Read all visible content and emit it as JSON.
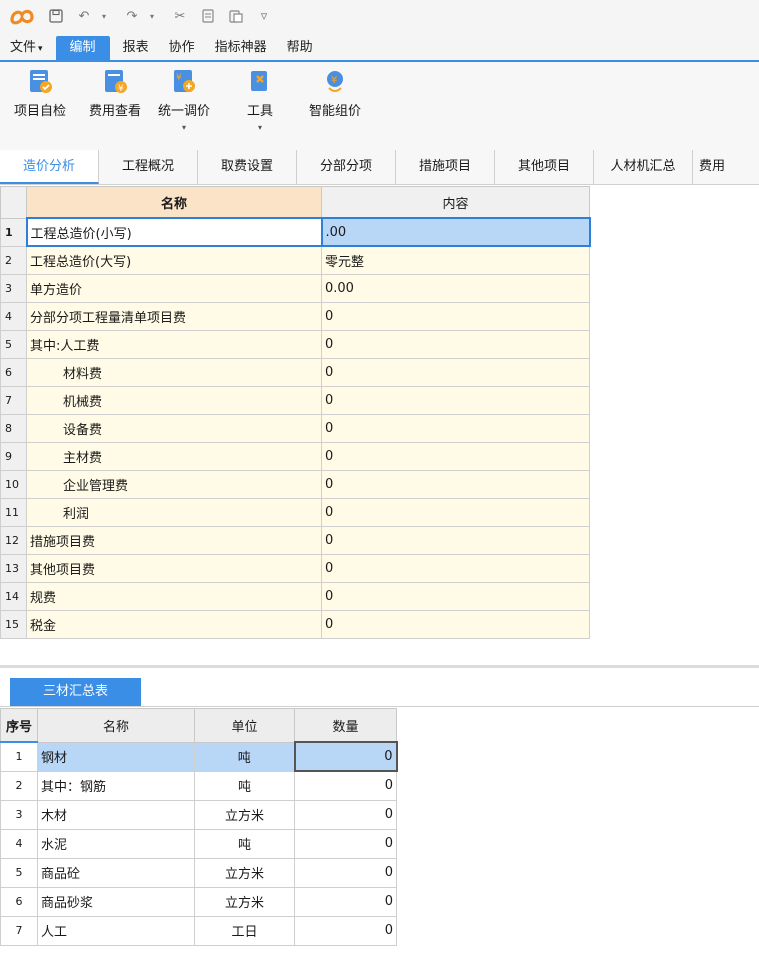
{
  "colors": {
    "accent": "#3a8ee6",
    "logo": "#f08a24",
    "header_name_bg": "#fbe3c8",
    "cell_bg": "#fffbe6",
    "selection": "#b8d6f6"
  },
  "quick_access": {
    "icons": [
      "app-logo-icon",
      "save-icon",
      "undo-icon",
      "redo-icon",
      "cut-icon",
      "copy-icon",
      "paste-icon",
      "customize-icon"
    ]
  },
  "menu": {
    "items": [
      {
        "label": "文件",
        "suffix": "▾"
      },
      {
        "label": "编制"
      },
      {
        "label": "报表"
      },
      {
        "label": "协作"
      },
      {
        "label": "指标神器"
      },
      {
        "label": "帮助"
      }
    ]
  },
  "ribbon": {
    "buttons": [
      {
        "label": "项目自检"
      },
      {
        "label": "费用查看"
      },
      {
        "label": "统一调价",
        "dropdown": "▾"
      },
      {
        "label": "工具",
        "dropdown": "▾"
      },
      {
        "label": "智能组价"
      }
    ]
  },
  "tabs": [
    "造价分析",
    "工程概况",
    "取费设置",
    "分部分项",
    "措施项目",
    "其他项目",
    "人材机汇总",
    "费用"
  ],
  "main_table": {
    "headers": {
      "name": "名称",
      "content": "内容"
    },
    "rows": [
      {
        "n": "1",
        "name": "工程总造价(小写)",
        "value": ".00"
      },
      {
        "n": "2",
        "name": "工程总造价(大写)",
        "value": "零元整"
      },
      {
        "n": "3",
        "name": "单方造价",
        "value": "0.00"
      },
      {
        "n": "4",
        "name": "分部分项工程量清单项目费",
        "value": "0"
      },
      {
        "n": "5",
        "name": "其中:人工费",
        "value": "0"
      },
      {
        "n": "6",
        "name": "材料费",
        "value": "0"
      },
      {
        "n": "7",
        "name": "机械费",
        "value": "0"
      },
      {
        "n": "8",
        "name": "设备费",
        "value": "0"
      },
      {
        "n": "9",
        "name": "主材费",
        "value": "0"
      },
      {
        "n": "10",
        "name": "企业管理费",
        "value": "0"
      },
      {
        "n": "11",
        "name": "利润",
        "value": "0"
      },
      {
        "n": "12",
        "name": "措施项目费",
        "value": "0"
      },
      {
        "n": "13",
        "name": "其他项目费",
        "value": "0"
      },
      {
        "n": "14",
        "name": "规费",
        "value": "0"
      },
      {
        "n": "15",
        "name": "税金",
        "value": "0"
      }
    ]
  },
  "materials": {
    "tab_label": "三材汇总表",
    "headers": {
      "seq": "序号",
      "name": "名称",
      "unit": "单位",
      "qty": "数量"
    },
    "rows": [
      {
        "n": "1",
        "name": "钢材",
        "unit": "吨",
        "qty": "0"
      },
      {
        "n": "2",
        "name": "其中：钢筋",
        "unit": "吨",
        "qty": "0"
      },
      {
        "n": "3",
        "name": "木材",
        "unit": "立方米",
        "qty": "0"
      },
      {
        "n": "4",
        "name": "水泥",
        "unit": "吨",
        "qty": "0"
      },
      {
        "n": "5",
        "name": "商品砼",
        "unit": "立方米",
        "qty": "0"
      },
      {
        "n": "6",
        "name": "商品砂浆",
        "unit": "立方米",
        "qty": "0"
      },
      {
        "n": "7",
        "name": "人工",
        "unit": "工日",
        "qty": "0"
      }
    ]
  }
}
